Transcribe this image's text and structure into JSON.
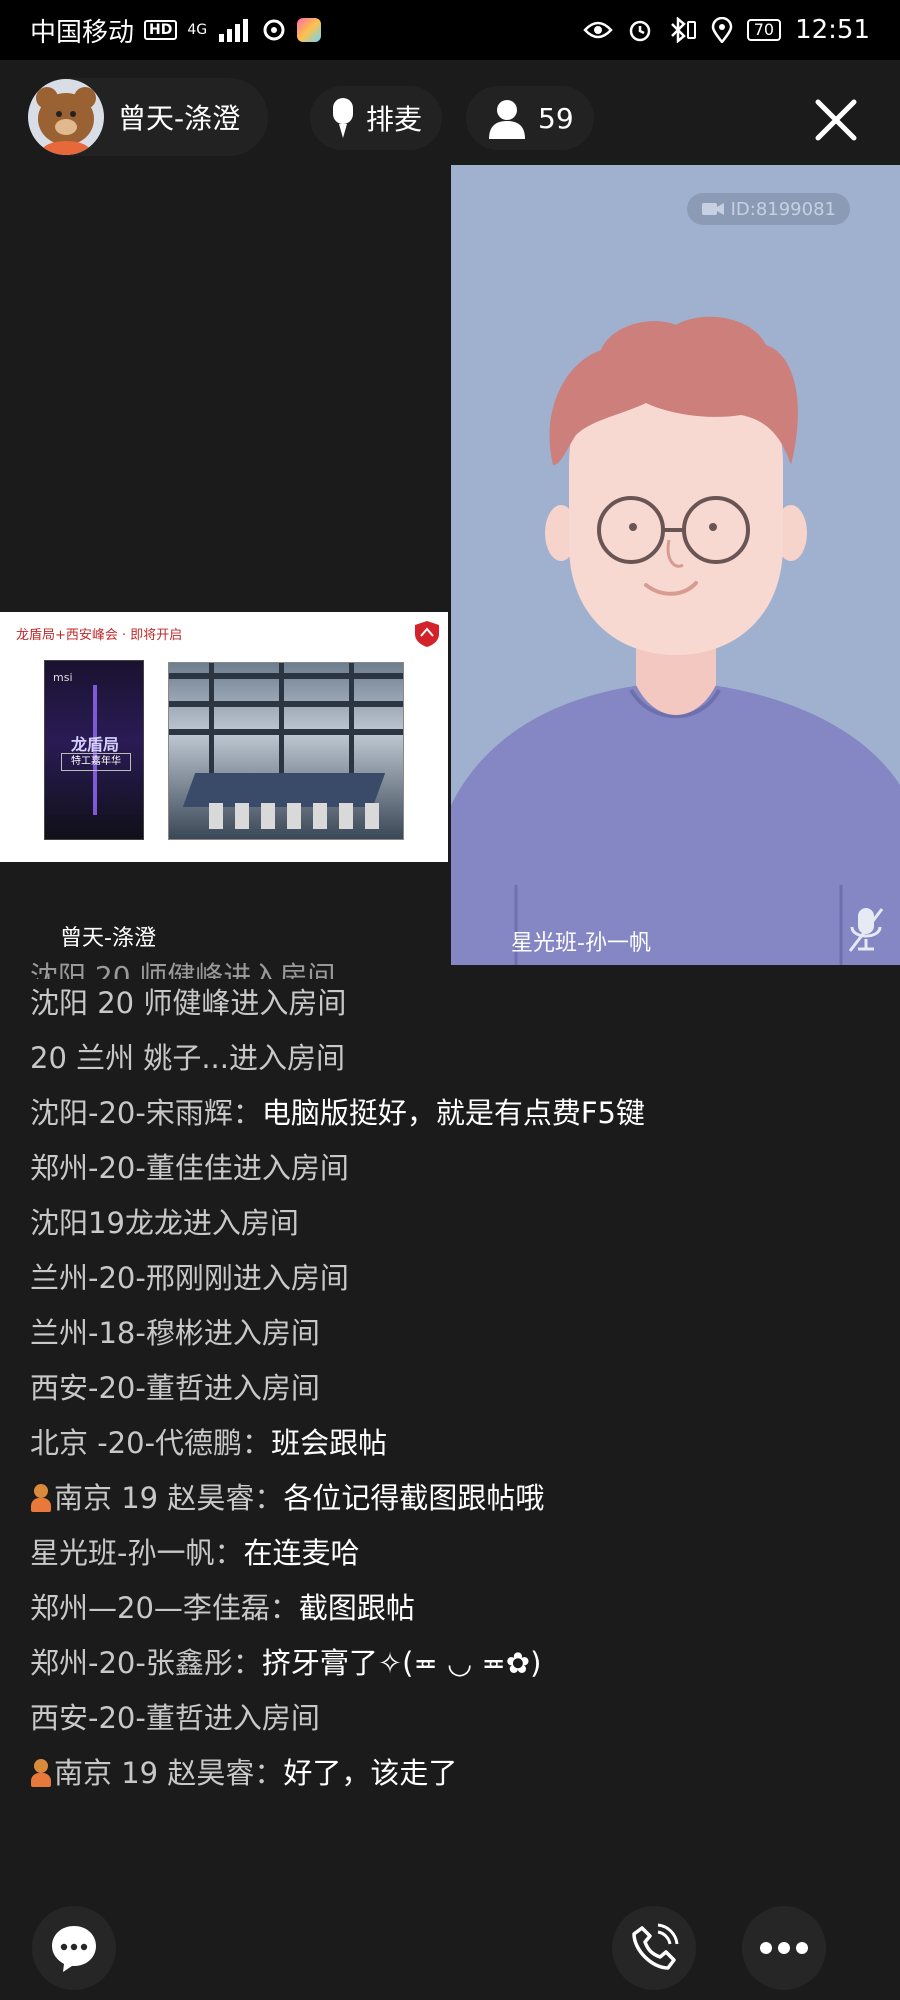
{
  "status_bar": {
    "carrier": "中国移动",
    "hd": "HD",
    "network": "4G",
    "battery": "70",
    "time": "12:51"
  },
  "top_bar": {
    "host_name": "曾天-涤澄",
    "queue_label": "排麦",
    "viewer_count": "59"
  },
  "videos": {
    "left": {
      "name": "曾天-涤澄",
      "banner_title": "龙盾局+西安峰会 · 即将开启",
      "poster_brand": "msi",
      "poster_title": "龙盾局",
      "poster_sub": "特工嘉年华"
    },
    "right": {
      "name": "星光班-孙一帆",
      "room_id": "ID:8199081"
    }
  },
  "chat": {
    "messages": [
      {
        "type": "join",
        "text": "沈阳 20 师健峰进入房间"
      },
      {
        "type": "join",
        "text": "20  兰州  姚子...进入房间"
      },
      {
        "type": "msg",
        "sender": "沈阳-20-宋雨辉：",
        "text": "电脑版挺好，就是有点费F5键",
        "badge": false
      },
      {
        "type": "join",
        "text": "郑州-20-董佳佳进入房间"
      },
      {
        "type": "join",
        "text": "沈阳19龙龙进入房间"
      },
      {
        "type": "join",
        "text": "兰州-20-邢刚刚进入房间"
      },
      {
        "type": "join",
        "text": "兰州-18-穆彬进入房间"
      },
      {
        "type": "join",
        "text": "西安-20-董哲进入房间"
      },
      {
        "type": "msg",
        "sender": "北京 -20-代德鹏：",
        "text": "班会跟帖",
        "badge": false
      },
      {
        "type": "msg",
        "sender": "南京 19 赵昊睿：",
        "text": "各位记得截图跟帖哦",
        "badge": true
      },
      {
        "type": "msg",
        "sender": "星光班-孙一帆：",
        "text": "在连麦哈",
        "badge": false
      },
      {
        "type": "msg",
        "sender": "郑州—20—李佳磊：",
        "text": "截图跟帖",
        "badge": false
      },
      {
        "type": "msg",
        "sender": "郑州-20-张鑫彤：",
        "text": "挤牙膏了✧(≖ ◡ ≖✿)",
        "badge": false
      },
      {
        "type": "join",
        "text": "西安-20-董哲进入房间"
      },
      {
        "type": "msg",
        "sender": "南京 19 赵昊睿：",
        "text": "好了，该走了",
        "badge": true
      }
    ]
  },
  "icons": {
    "close": "close-icon",
    "mic": "microphone-icon",
    "person": "person-icon",
    "chat": "chat-bubble-icon",
    "call": "phone-icon",
    "more": "more-icon",
    "mic_off": "mic-muted-icon"
  }
}
